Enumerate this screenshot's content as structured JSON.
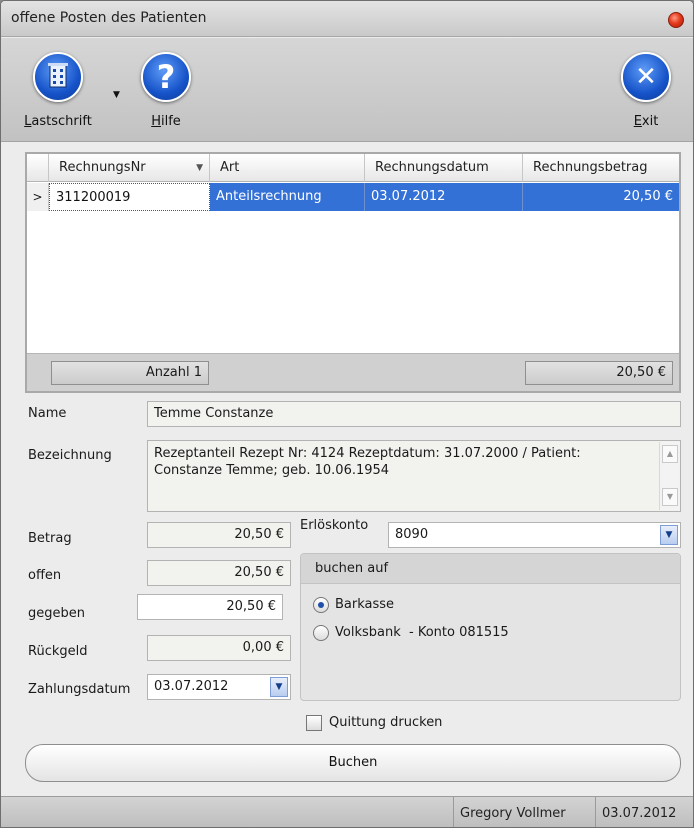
{
  "window": {
    "title": "offene Posten des Patienten"
  },
  "toolbar": {
    "lastschrift": {
      "label_hotkey": "L",
      "label_rest": "astschrift",
      "icon": "building-icon"
    },
    "hilfe": {
      "label_hotkey": "H",
      "label_rest": "ilfe",
      "icon": "question-icon",
      "glyph": "?"
    },
    "exit": {
      "label_hotkey": "E",
      "label_rest": "xit",
      "icon": "close-x-icon",
      "glyph": "✕"
    }
  },
  "grid": {
    "columns": [
      "RechnungsNr",
      "Art",
      "Rechnungsdatum",
      "Rechnungsbetrag"
    ],
    "rows": [
      {
        "nr": "311200019",
        "art": "Anteilsrechnung",
        "datum": "03.07.2012",
        "betrag": "20,50 €"
      }
    ],
    "row_indicator": ">",
    "footer": {
      "count": "Anzahl 1",
      "sum": "20,50 €"
    }
  },
  "form": {
    "name_label": "Name",
    "name_value": "Temme Constanze",
    "bezeichnung_label": "Bezeichnung",
    "bezeichnung_value": "Rezeptanteil Rezept Nr: 4124 Rezeptdatum: 31.07.2000 / Patient: Constanze Temme; geb. 10.06.1954",
    "betrag_label": "Betrag",
    "betrag_value": "20,50 €",
    "offen_label": "offen",
    "offen_value": "20,50 €",
    "gegeben_label": "gegeben",
    "gegeben_value": "20,50 €",
    "rueckgeld_label": "Rückgeld",
    "rueckgeld_value": "0,00 €",
    "zahlungsdatum_label": "Zahlungsdatum",
    "zahlungsdatum_value": "03.07.2012",
    "erloeskonto_label": "Erlöskonto",
    "erloeskonto_value": "8090"
  },
  "buchen_auf": {
    "title": "buchen auf",
    "options": [
      {
        "label": "Barkasse",
        "checked": true
      },
      {
        "label": "Volksbank  - Konto 081515",
        "checked": false
      }
    ]
  },
  "quittung": {
    "label": "Quittung drucken",
    "checked": false
  },
  "buchen_button": "Buchen",
  "status": {
    "user": "Gregory Vollmer",
    "date": "03.07.2012"
  }
}
